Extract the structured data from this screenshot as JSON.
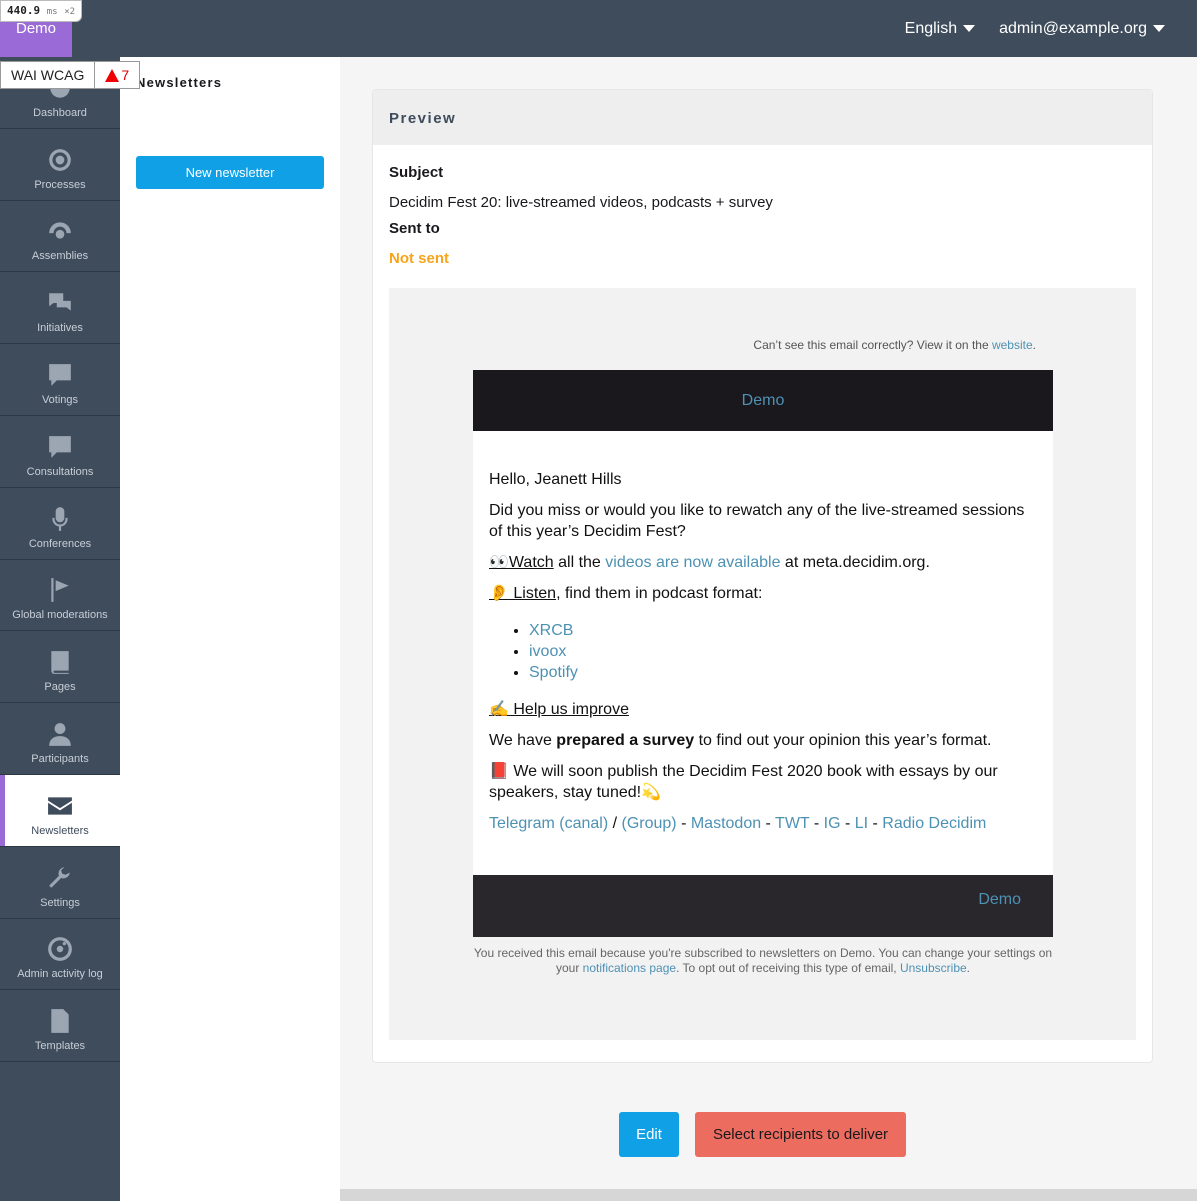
{
  "perf": {
    "value": "440.9",
    "unit": "ms",
    "mult": "×2"
  },
  "brand": "Demo",
  "topnav": {
    "language": "English",
    "user": "admin@example.org"
  },
  "wcag": {
    "label": "WAI WCAG",
    "count": "7"
  },
  "sidebar": {
    "items": [
      {
        "label": "Dashboard",
        "icon": "dashboard-icon"
      },
      {
        "label": "Processes",
        "icon": "target-icon"
      },
      {
        "label": "Assemblies",
        "icon": "assemblies-icon"
      },
      {
        "label": "Initiatives",
        "icon": "chat-bubbles-icon"
      },
      {
        "label": "Votings",
        "icon": "speech-bubble-icon"
      },
      {
        "label": "Consultations",
        "icon": "speech-bubble-icon"
      },
      {
        "label": "Conferences",
        "icon": "microphone-icon"
      },
      {
        "label": "Global moderations",
        "icon": "flag-icon"
      },
      {
        "label": "Pages",
        "icon": "book-icon"
      },
      {
        "label": "Participants",
        "icon": "person-icon"
      },
      {
        "label": "Newsletters",
        "icon": "envelope-icon"
      },
      {
        "label": "Settings",
        "icon": "wrench-icon"
      },
      {
        "label": "Admin activity log",
        "icon": "activity-icon"
      },
      {
        "label": "Templates",
        "icon": "document-icon"
      }
    ],
    "active": "Newsletters"
  },
  "subnav": {
    "title": "Newsletters",
    "new_button": "New newsletter"
  },
  "preview": {
    "title": "Preview",
    "subject_label": "Subject",
    "subject": "Decidim Fest 20: live-streamed videos, podcasts + survey",
    "sent_to_label": "Sent to",
    "sent_to": "Not sent"
  },
  "email": {
    "view_web_text": "Can’t see this email correctly? View it on the",
    "view_web_link": "website",
    "header_org": "Demo",
    "greeting": "Hello, Jeanett Hills",
    "intro": "Did you miss or would you like to rewatch any of the live-streamed sessions of this year’s Decidim Fest?",
    "watch_emoji": "👀",
    "watch_label": "Watch",
    "watch_mid": " all the ",
    "watch_link": "videos are now available",
    "watch_end": " at meta.decidim.org.",
    "listen_emoji": "👂",
    "listen_label": " Listen",
    "listen_end": ", find them in podcast format:",
    "podcasts": [
      "XRCB",
      "ivoox",
      "Spotify"
    ],
    "help_emoji": "✍️",
    "help_label": " Help us improve",
    "survey_start": "We have ",
    "survey_bold": "prepared a survey",
    "survey_end": " to find out your opinion this year’s format.",
    "book_emoji": "📕",
    "book_text": " We will soon publish the Decidim Fest 2020 book with essays by our speakers, stay tuned!",
    "book_end_emoji": "💫",
    "social": [
      {
        "label": "Telegram (canal)",
        "sep": " / "
      },
      {
        "label": "(Group)",
        "sep": " - "
      },
      {
        "label": "Mastodon",
        "sep": " - "
      },
      {
        "label": "TWT",
        "sep": " - "
      },
      {
        "label": "IG",
        "sep": " - "
      },
      {
        "label": "LI",
        "sep": " - "
      },
      {
        "label": "Radio Decidim",
        "sep": ""
      }
    ],
    "footer_org": "Demo",
    "legal_start": "You received this email because you're subscribed to newsletters on Demo. You can change your settings on your ",
    "legal_link1": "notifications page",
    "legal_mid": ". To opt out of receiving this type of email, ",
    "legal_link2": "Unsubscribe",
    "legal_end": "."
  },
  "actions": {
    "edit": "Edit",
    "select": "Select recipients to deliver"
  },
  "colors": {
    "topbar": "#3e4c5c",
    "brand": "#9a6bd6",
    "primary": "#0fa0e6",
    "alert": "#ec6c5f",
    "warning": "#f7a41d",
    "link": "#4d91b3"
  }
}
